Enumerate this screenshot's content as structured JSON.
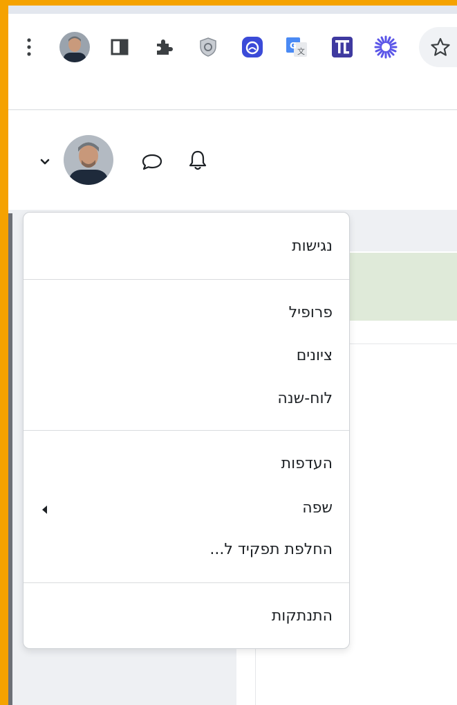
{
  "browser": {
    "icons": [
      "kebab-menu-icon",
      "profile-avatar",
      "side-panel-icon",
      "extensions-puzzle-icon",
      "shield-extension-icon",
      "blue-extension-icon",
      "google-translate-icon",
      "il-extension-icon",
      "sun-extension-icon",
      "bookmark-star-icon"
    ]
  },
  "navbar": {
    "icons": [
      "chevron-down-icon",
      "user-avatar",
      "chat-bubble-icon",
      "bell-icon"
    ]
  },
  "user_menu": {
    "groups": [
      {
        "items": [
          {
            "label": "נגישות"
          }
        ]
      },
      {
        "items": [
          {
            "label": "פרופיל"
          },
          {
            "label": "ציונים"
          },
          {
            "label": "לוח-שנה"
          }
        ]
      },
      {
        "items": [
          {
            "label": "העדפות"
          },
          {
            "label": "שפה",
            "has_submenu": true
          },
          {
            "label": "החלפת תפקיד ל..."
          }
        ]
      },
      {
        "items": [
          {
            "label": "התנתקות"
          }
        ]
      }
    ]
  },
  "colors": {
    "frame": "#f5a200",
    "menu_text": "#1d2125",
    "extension_blue": "#3b4bd8",
    "extension_purple": "#3f3aa0",
    "sun": "#5a55e8"
  }
}
